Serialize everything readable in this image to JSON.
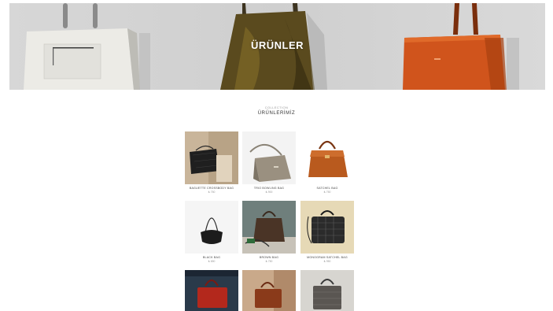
{
  "hero": {
    "title": "ÜRÜNLER"
  },
  "section": {
    "kicker": "COLLECTION",
    "title": "ÜRÜNLERİMİZ"
  },
  "products": [
    {
      "name": "BAGUETTE CROSSBODY BAG",
      "price": "₺ 750"
    },
    {
      "name": "TRIO BOWLING BAG",
      "price": "₺ 900"
    },
    {
      "name": "SATCHEL BAG",
      "price": "₺ 750"
    },
    {
      "name": "BLACK BAG",
      "price": "₺ 650"
    },
    {
      "name": "BROWN BAG",
      "price": "₺ 750"
    },
    {
      "name": "MONOGRAM SATCHEL BAG",
      "price": "₺ 950"
    },
    {
      "name": "",
      "price": ""
    },
    {
      "name": "",
      "price": ""
    },
    {
      "name": "",
      "price": ""
    }
  ]
}
